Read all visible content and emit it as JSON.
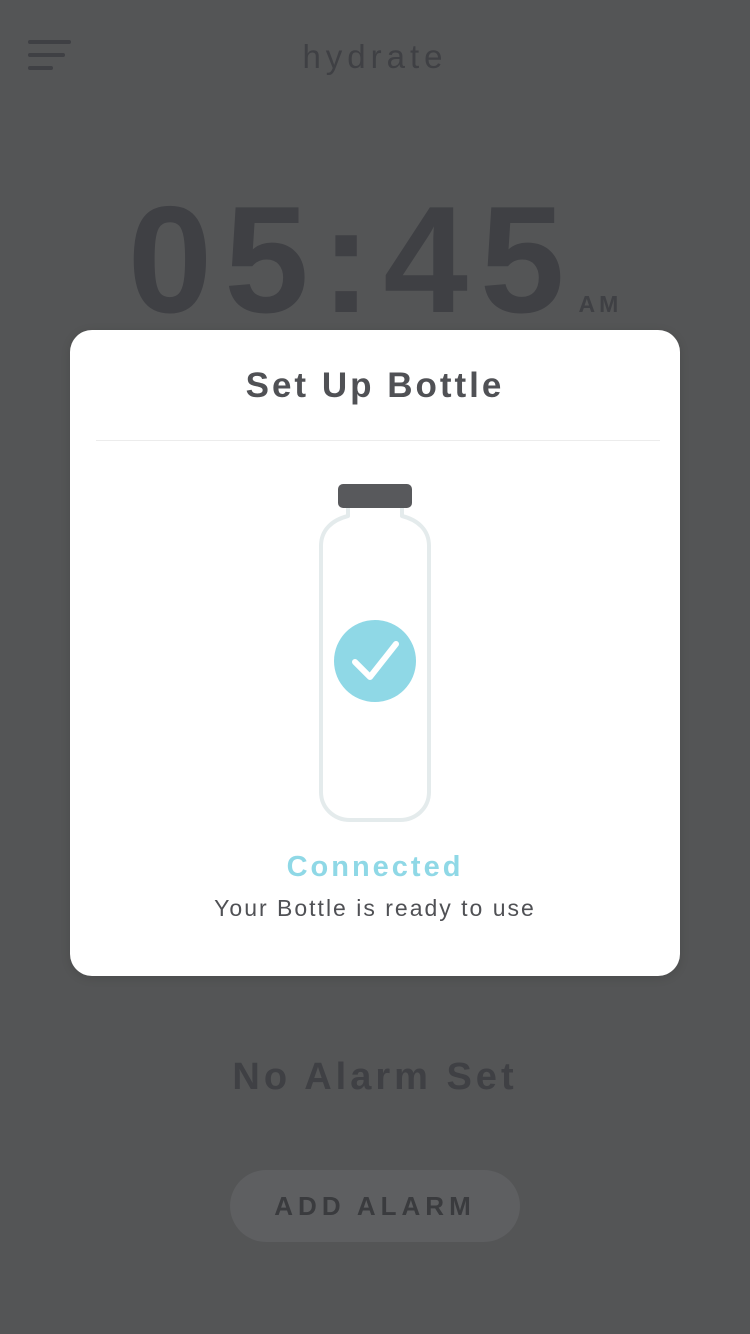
{
  "header": {
    "title": "hydrate",
    "menu_icon": "hamburger-menu-icon"
  },
  "clock": {
    "time": "05:45",
    "period": "AM"
  },
  "alarm": {
    "status": "No Alarm Set",
    "add_label": "ADD ALARM"
  },
  "modal": {
    "title": "Set Up Bottle",
    "status": "Connected",
    "message": "Your Bottle is ready to use",
    "bottle_icon": "water-bottle-icon",
    "check_icon": "checkmark-icon"
  },
  "colors": {
    "overlay_background": "#545556",
    "text_dark": "#3f4044",
    "accent": "#8fd8e6",
    "cap": "#58595c",
    "bottle_outline": "#e4ebec"
  }
}
